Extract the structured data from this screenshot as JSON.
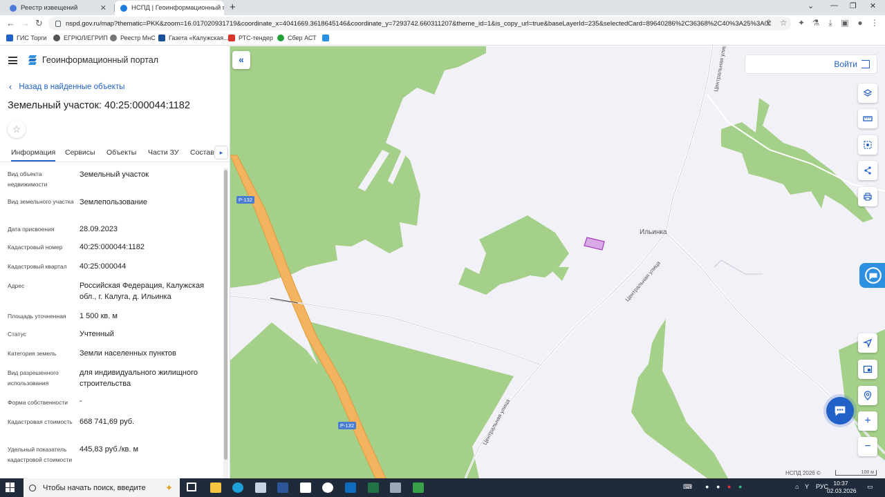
{
  "browser": {
    "tabs": [
      {
        "title": "Реестр извещений",
        "active": false
      },
      {
        "title": "НСПД | Геоинформационный п",
        "active": true
      }
    ],
    "url": "nspd.gov.ru/map?thematic=PKK&zoom=16.017020931719&coordinate_x=4041669.3618645146&coordinate_y=7293742.660311207&theme_id=1&is_copy_url=true&baseLayerId=235&selectedCard=89640286%2C36368%2C40%3A25%3A00...",
    "bookmarks": [
      "ГИС Торги",
      "ЕГРЮЛ/ЕГРИП",
      "Реестр МнС",
      "Газета «Калужская...",
      "РТС-тендер",
      "Сбер АСТ"
    ]
  },
  "header": {
    "portal_name": "Геоинформационный портал"
  },
  "card": {
    "back_label": "Назад в найденные объекты",
    "title": "Земельный участок: 40:25:000044:1182",
    "tabs": [
      "Информация",
      "Сервисы",
      "Объекты",
      "Части ЗУ",
      "Состав"
    ],
    "properties": [
      {
        "label": "Вид объекта недвижимости",
        "value": "Земельный участок"
      },
      {
        "label": "Вид земельного участка",
        "value": "Землепользование"
      },
      {
        "label": "Дата присвоения",
        "value": "28.09.2023"
      },
      {
        "label": "Кадастровый номер",
        "value": "40:25:000044:1182"
      },
      {
        "label": "Кадастровый квартал",
        "value": "40:25:000044"
      },
      {
        "label": "Адрес",
        "value": "Российская Федерация, Калужская обл., г. Калуга, д. Ильинка"
      },
      {
        "label": "Площадь уточненная",
        "value": "1 500 кв. м"
      },
      {
        "label": "Статус",
        "value": "Учтенный"
      },
      {
        "label": "Категория земель",
        "value": "Земли населенных пунктов"
      },
      {
        "label": "Вид разрешенного использования",
        "value": "для индивидуального жилищного строительства"
      },
      {
        "label": "Форма собственности",
        "value": "-"
      },
      {
        "label": "Кадастровая стоимость",
        "value": "668 741,69 руб."
      },
      {
        "label": "Удельный показатель кадастровой стоимости",
        "value": "445,83 руб./кв. м"
      }
    ]
  },
  "map": {
    "login_label": "Войти",
    "village_label": "Ильинка",
    "street_label": "Центральная улица",
    "road_label": "Р-132",
    "copyright": "НСПД 2026 ©",
    "scale": "100 м",
    "colors": {
      "forest": "#a5d08a",
      "road": "#f4b35e",
      "parcel": "#d9a8e6",
      "accent": "#2160c7"
    }
  },
  "taskbar": {
    "search_placeholder": "Чтобы начать поиск, введите",
    "lang": "РУС",
    "time": "10:37",
    "date": "02.03.2026"
  }
}
